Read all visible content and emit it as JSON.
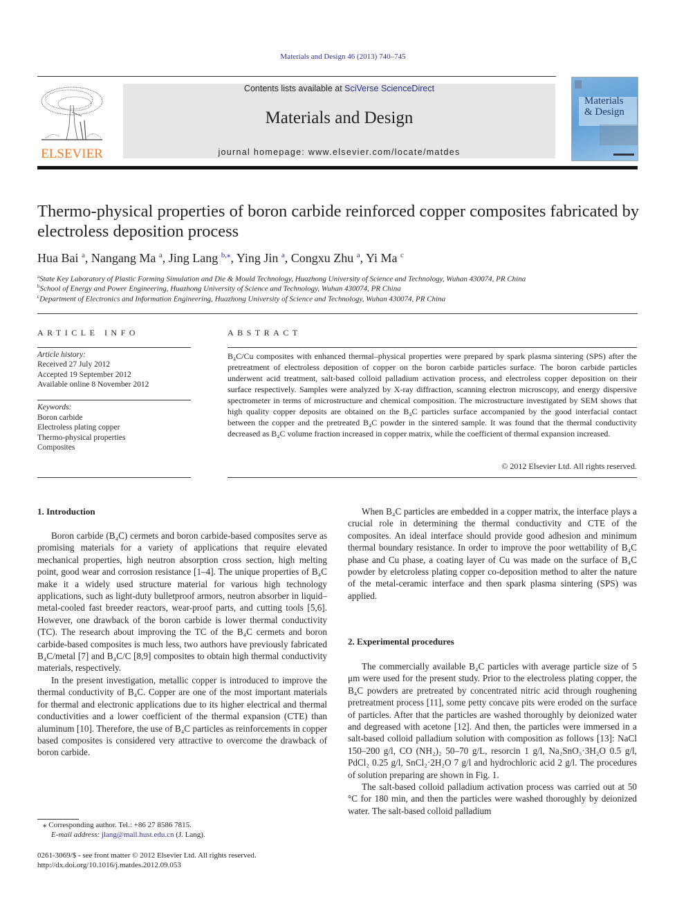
{
  "header": {
    "running_head": "Materials and Design 46 (2013) 740–745",
    "publisher_logo_text": "ELSEVIER",
    "contents_prefix": "Contents lists available at ",
    "contents_link": "SciVerse ScienceDirect",
    "journal_name": "Materials and Design",
    "homepage": "journal homepage: www.elsevier.com/locate/matdes",
    "cover_title_line1": "Materials",
    "cover_title_line2": "& Design"
  },
  "article": {
    "title": "Thermo-physical properties of boron carbide reinforced copper composites fabricated by electroless deposition process",
    "authors": [
      {
        "name": "Hua Bai",
        "sup": "a",
        "sep": ", "
      },
      {
        "name": "Nangang Ma",
        "sup": "a",
        "sep": ", "
      },
      {
        "name": "Jing Lang",
        "sup": "b,⁎",
        "sep": ", "
      },
      {
        "name": "Ying Jin",
        "sup": "a",
        "sep": ", "
      },
      {
        "name": "Congxu Zhu",
        "sup": "a",
        "sep": ", "
      },
      {
        "name": "Yi Ma",
        "sup": "c",
        "sep": ""
      }
    ],
    "affiliations": [
      {
        "key": "a",
        "text": "State Key Laboratory of Plastic Forming Simulation and Die & Mould Technology, Huazhong University of Science and Technology, Wuhan 430074, PR China"
      },
      {
        "key": "b",
        "text": "School of Energy and Power Engineering, Huazhong University of Science and Technology, Wuhan 430074, PR China"
      },
      {
        "key": "c",
        "text": "Department of Electronics and Information Engineering, Huazhong University of Science and Technology, Wuhan 430074, PR China"
      }
    ]
  },
  "article_info": {
    "heading": "ARTICLE INFO",
    "history_label": "Article history:",
    "received": "Received 27 July 2012",
    "accepted": "Accepted 19 September 2012",
    "online": "Available online 8 November 2012",
    "keywords_label": "Keywords:",
    "keywords": [
      "Boron carbide",
      "Electroless plating copper",
      "Thermo-physical properties",
      "Composites"
    ]
  },
  "abstract": {
    "heading": "ABSTRACT",
    "text": "B₄C/Cu composites with enhanced thermal–physical properties were prepared by spark plasma sintering (SPS) after the pretreatment of electroless deposition of copper on the boron carbide particles surface. The boron carbide particles underwent acid treatment, salt-based colloid palladium activation process, and electroless copper deposition on their surface respectively. Samples were analyzed by X-ray diffraction, scanning electron microscopy, and energy dispersive spectrometer in terms of microstructure and chemical composition. The microstructure investigated by SEM shows that high quality copper deposits are obtained on the B₄C particles surface accompanied by the good interfacial contact between the copper and the pretreated B₄C powder in the sintered sample. It was found that the thermal conductivity decreased as B₄C volume fraction increased in copper matrix, while the coefficient of thermal expansion increased.",
    "copyright": "© 2012 Elsevier Ltd. All rights reserved."
  },
  "sections": {
    "intro_heading": "1. Introduction",
    "intro_p1": "Boron carbide (B₄C) cermets and boron carbide-based composites serve as promising materials for a variety of applications that require elevated mechanical properties, high neutron absorption cross section, high melting point, good wear and corrosion resistance [1–4]. The unique properties of B₄C make it a widely used structure material for various high technology applications, such as light-duty bulletproof armors, neutron absorber in liquid–metal-cooled fast breeder reactors, wear-proof parts, and cutting tools [5,6]. However, one drawback of the boron carbide is lower thermal conductivity (TC). The research about improving the TC of the B₄C cermets and boron carbide-based composites is much less, two authors have previously fabricated B₄C/metal [7] and B₄C/C [8,9] composites to obtain high thermal conductivity materials, respectively.",
    "intro_p2": "In the present investigation, metallic copper is introduced to improve the thermal conductivity of B₄C. Copper are one of the most important materials for thermal and electronic applications due to its higher electrical and thermal conductivities and a lower coefficient of the thermal expansion (CTE) than aluminum [10]. Therefore, the use of B₄C particles as reinforcements in copper based composites is considered very attractive to overcome the drawback of boron carbide.",
    "intro_p3": "When B₄C particles are embedded in a copper matrix, the interface plays a crucial role in determining the thermal conductivity and CTE of the composites. An ideal interface should provide good adhesion and minimum thermal boundary resistance. In order to improve the poor wettability of B₄C phase and Cu phase, a coating layer of Cu was made on the surface of B₄C powder by eletcroless plating copper co-deposition method to alter the nature of the metal-ceramic interface and then spark plasma sintering (SPS) was applied.",
    "exp_heading": "2. Experimental procedures",
    "exp_p1": "The commercially available B₄C particles with average particle size of 5 μm were used for the present study. Prior to the electroless plating copper, the B₄C powders are pretreated by concentrated nitric acid through roughening pretreatment process [11], some petty concave pits were eroded on the surface of particles. After that the particles are washed thoroughly by deionized water and degreased with acetone [12]. And then, the particles were immersed in a salt-based colloid palladium solution with composition as follows [13]: NaCl 150–200 g/l, CO (NH₂)₂ 50–70 g/L, resorcin 1 g/l, Na₂SnO₃·3H₂O 0.5 g/l, PdCl₂ 0.25 g/l, SnCl₂·2H₂O 7 g/l and hydrochloric acid 2 g/l. The procedures of solution preparing are shown in Fig. 1.",
    "exp_p2": "The salt-based colloid palladium activation process was carried out at 50 °C for 180 min, and then the particles were washed thoroughly by deionized water. The salt-based colloid palladium"
  },
  "footnotes": {
    "corresponding": "⁎ Corresponding author. Tel.: +86 27 8586 7815.",
    "email_label": "E-mail address: ",
    "email": "jlang@mail.hust.edu.cn",
    "email_suffix": " (J. Lang).",
    "issn": "0261-3069/$ - see front matter © 2012 Elsevier Ltd. All rights reserved.",
    "doi": "http://dx.doi.org/10.1016/j.matdes.2012.09.053"
  },
  "colors": {
    "link": "#2e3192",
    "elsevier_orange": "#f47920",
    "banner_gray": "#e6e6e6"
  }
}
